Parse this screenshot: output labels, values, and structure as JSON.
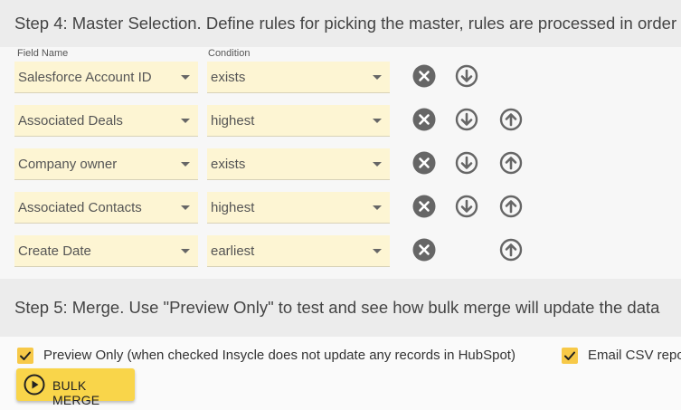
{
  "step4": {
    "title": "Step 4: Master Selection. Define rules for picking the master, rules are processed in order"
  },
  "columns": {
    "field": "Field Name",
    "condition": "Condition"
  },
  "rules": [
    {
      "field": "Salesforce Account ID",
      "condition": "exists",
      "buttons": [
        "remove",
        "move-down"
      ]
    },
    {
      "field": "Associated Deals",
      "condition": "highest",
      "buttons": [
        "remove",
        "move-down",
        "move-up"
      ]
    },
    {
      "field": "Company owner",
      "condition": "exists",
      "buttons": [
        "remove",
        "move-down",
        "move-up"
      ]
    },
    {
      "field": "Associated Contacts",
      "condition": "highest",
      "buttons": [
        "remove",
        "move-down",
        "move-up"
      ]
    },
    {
      "field": "Create Date",
      "condition": "earliest",
      "buttons": [
        "remove",
        "move-up"
      ]
    }
  ],
  "step5": {
    "title": "Step 5: Merge. Use \"Preview Only\" to test and see how bulk merge will update the data"
  },
  "options": {
    "preview_only": {
      "label": "Preview Only (when checked Insycle does not update any records in HubSpot)",
      "checked": true
    },
    "email_csv": {
      "label": "Email CSV report",
      "checked": true
    }
  },
  "bulk_merge": {
    "label": "BULK MERGE"
  },
  "colors": {
    "field_bg": "#fdf5d3",
    "accent": "#f9d54a",
    "icon": "#666666",
    "header_bg": "#ececec"
  }
}
